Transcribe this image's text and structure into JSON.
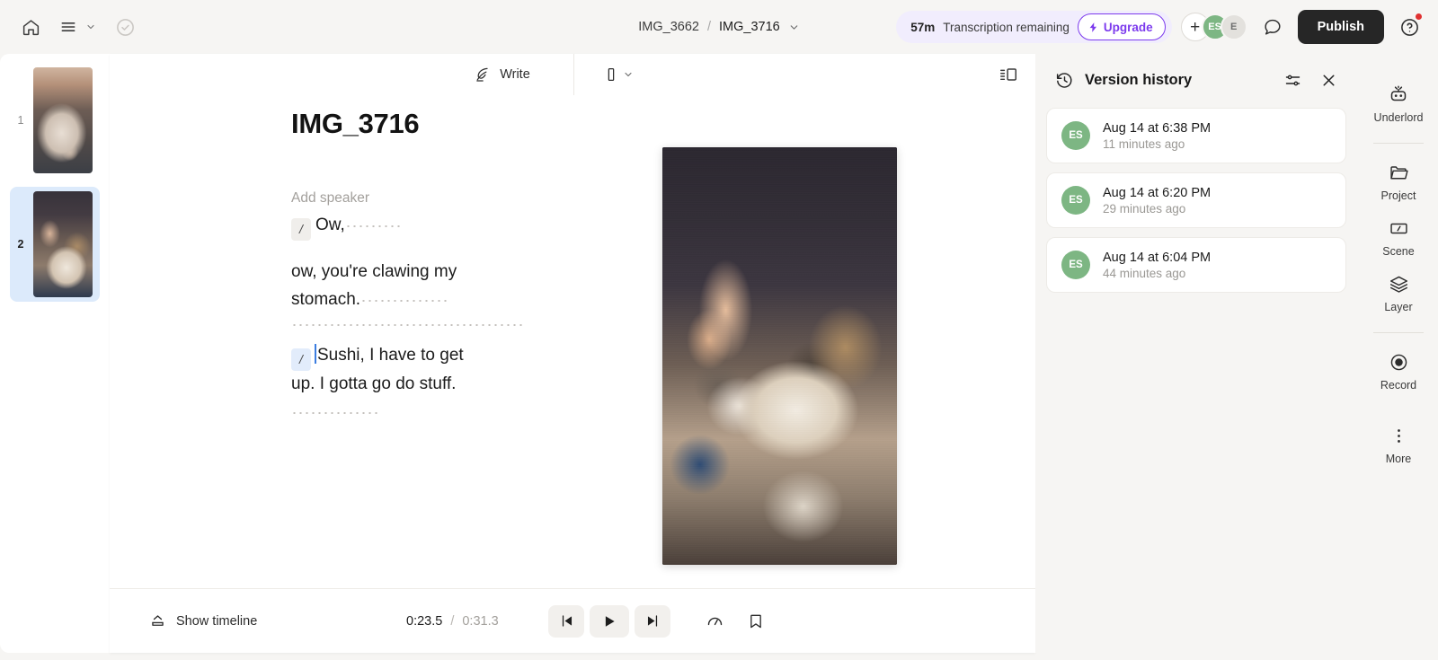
{
  "topbar": {
    "home_icon": "home-icon",
    "menu_icon": "hamburger-menu-icon",
    "saved_icon": "circle-check-icon",
    "breadcrumb": {
      "parent": "IMG_3662",
      "separator": "/",
      "current": "IMG_3716"
    },
    "quota": {
      "minutes": "57m",
      "label": "Transcription remaining"
    },
    "upgrade_label": "Upgrade",
    "upgrade_icon": "lightning-bolt-icon",
    "upgrade_color": "#7c3aed",
    "avatars": [
      {
        "name": "add-collaborator",
        "initials": "+",
        "color": "#ffffff"
      },
      {
        "name": "collaborator-es",
        "initials": "ES",
        "color": "#7db683"
      },
      {
        "name": "collaborator-e",
        "initials": "E",
        "color": "#e3e1dd"
      }
    ],
    "comment_icon": "comment-bubble-icon",
    "publish_label": "Publish",
    "help_icon": "help-circle-icon",
    "help_badge_color": "#e03131"
  },
  "scenes": {
    "items": [
      {
        "number": "1",
        "name": "scene-thumbnail-1",
        "selected": false
      },
      {
        "number": "2",
        "name": "scene-thumbnail-2",
        "selected": true
      }
    ]
  },
  "editor_toolbar": {
    "write_label": "Write",
    "write_icon": "quill-pen-icon",
    "aspect_ratio_icon": "portrait-frame-icon",
    "aspect_ratio_chevron": "chevron-down-icon",
    "panel_toggle_icon": "right-panel-toggle-icon"
  },
  "transcript": {
    "title": "IMG_3716",
    "add_speaker": "Add speaker",
    "paragraphs": [
      {
        "badge": "/",
        "text": "Ow,",
        "caret": false
      },
      {
        "badge": "",
        "text": "ow, you're  clawing my stomach.",
        "caret": false
      },
      {
        "badge": "/",
        "text": "Sushi, I have to get up. I gotta go do stuff.",
        "caret": true
      }
    ],
    "caret_color": "#3b7de0"
  },
  "preview": {
    "name": "video-preview-frame",
    "description": "Hand petting a calico cat"
  },
  "footer": {
    "show_timeline_label": "Show timeline",
    "show_timeline_icon": "timeline-expand-icon",
    "current_time": "0:23.5",
    "time_separator": "/",
    "total_time": "0:31.3",
    "skip_back_icon": "skip-to-start-icon",
    "play_icon": "play-icon",
    "skip_forward_icon": "skip-to-end-icon",
    "speed_icon": "playback-speed-icon",
    "bookmark_icon": "bookmark-icon"
  },
  "version_history": {
    "history_icon": "clock-rewind-icon",
    "title": "Version history",
    "settings_icon": "sliders-icon",
    "close_icon": "close-icon",
    "items": [
      {
        "initials": "ES",
        "date": "Aug 14 at 6:38 PM",
        "ago": "11 minutes ago"
      },
      {
        "initials": "ES",
        "date": "Aug 14 at 6:20 PM",
        "ago": "29 minutes ago"
      },
      {
        "initials": "ES",
        "date": "Aug 14 at 6:04 PM",
        "ago": "44 minutes ago"
      }
    ],
    "avatar_color": "#7db683"
  },
  "rail": {
    "items": [
      {
        "label": "Underlord",
        "icon": "robot-icon"
      },
      {
        "label": "Project",
        "icon": "folder-icon"
      },
      {
        "label": "Scene",
        "icon": "scene-frame-icon"
      },
      {
        "label": "Layer",
        "icon": "layers-icon"
      },
      {
        "label": "Record",
        "icon": "record-circle-icon"
      },
      {
        "label": "More",
        "icon": "more-vertical-icon"
      }
    ]
  }
}
